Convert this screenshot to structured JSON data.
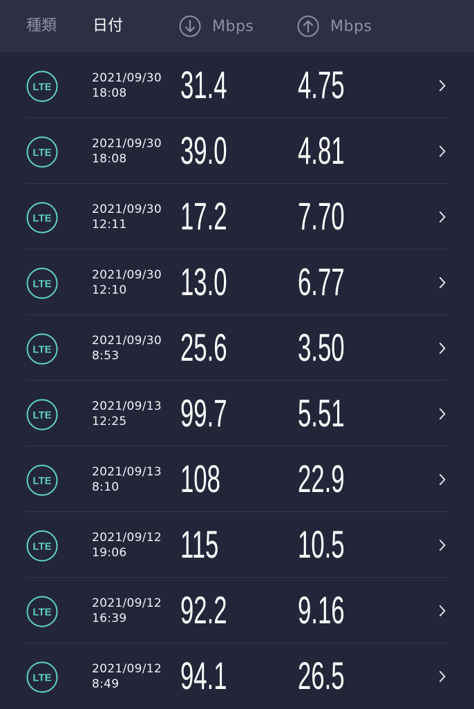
{
  "header": {
    "type_label": "種類",
    "date_label": "日付",
    "download_unit": "Mbps",
    "upload_unit": "Mbps"
  },
  "icons": {
    "download": "arrow-down-circle-icon",
    "upload": "arrow-up-circle-icon",
    "network": "lte-badge-icon",
    "detail": "chevron-right-icon"
  },
  "colors": {
    "background": "#232538",
    "header_background": "#2d3042",
    "lte_accent": "#5fd0c4"
  },
  "results": [
    {
      "type": "LTE",
      "date": "2021/09/30",
      "time": "18:08",
      "download": "31.4",
      "upload": "4.75"
    },
    {
      "type": "LTE",
      "date": "2021/09/30",
      "time": "18:08",
      "download": "39.0",
      "upload": "4.81"
    },
    {
      "type": "LTE",
      "date": "2021/09/30",
      "time": "12:11",
      "download": "17.2",
      "upload": "7.70"
    },
    {
      "type": "LTE",
      "date": "2021/09/30",
      "time": "12:10",
      "download": "13.0",
      "upload": "6.77"
    },
    {
      "type": "LTE",
      "date": "2021/09/30",
      "time": "8:53",
      "download": "25.6",
      "upload": "3.50"
    },
    {
      "type": "LTE",
      "date": "2021/09/13",
      "time": "12:25",
      "download": "99.7",
      "upload": "5.51"
    },
    {
      "type": "LTE",
      "date": "2021/09/13",
      "time": "8:10",
      "download": "108",
      "upload": "22.9"
    },
    {
      "type": "LTE",
      "date": "2021/09/12",
      "time": "19:06",
      "download": "115",
      "upload": "10.5"
    },
    {
      "type": "LTE",
      "date": "2021/09/12",
      "time": "16:39",
      "download": "92.2",
      "upload": "9.16"
    },
    {
      "type": "LTE",
      "date": "2021/09/12",
      "time": "8:49",
      "download": "94.1",
      "upload": "26.5"
    }
  ]
}
